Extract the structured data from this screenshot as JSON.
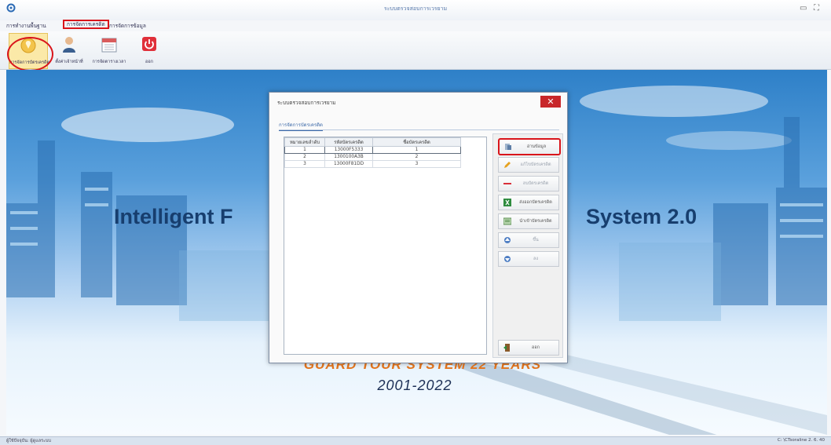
{
  "window": {
    "title": "ระบบตรวจสอบการเวรยาม",
    "minimize_glyph": "▭",
    "close_glyph": "⛶"
  },
  "menu": [
    {
      "label": "การทำงานพื้นฐาน",
      "active": false
    },
    {
      "label": "การจัดการเครดิต",
      "active": true
    },
    {
      "label": "การจัดการข้อมูล",
      "active": false
    }
  ],
  "ribbon": [
    {
      "label": "การจัดการบัตรเครดิต",
      "icon": "credit-card-icon",
      "selected": true
    },
    {
      "label": "ตั้งค่าเจ้าหน้าที่",
      "icon": "person-icon",
      "selected": false
    },
    {
      "label": "การจัดตารางเวลา",
      "icon": "calendar-icon",
      "selected": false
    },
    {
      "label": "ออก",
      "icon": "power-icon",
      "selected": false
    }
  ],
  "background": {
    "headline_left": "Intelligent F",
    "headline_right": "System 2.0",
    "tagline": "GUARD TOUR SYSTEM 22 YEARS",
    "years": "2001-2022"
  },
  "dialog": {
    "title": "ระบบตรวจสอบการเวรยาม",
    "close_glyph": "✕",
    "tab": "การจัดการบัตรเครดิต",
    "table": {
      "columns": [
        "หมายเลขลำดับ",
        "รหัสบัตรเครดิต",
        "ชื่อบัตรเครดิต"
      ],
      "rows": [
        [
          "1",
          "13000F5333",
          "1"
        ],
        [
          "2",
          "1300100A3B",
          "2"
        ],
        [
          "3",
          "13000F81DD",
          "3"
        ]
      ]
    },
    "buttons": [
      {
        "label": "อ่านข้อมูล",
        "icon": "read-card-icon",
        "enabled": true,
        "highlighted": true
      },
      {
        "label": "แก้ไขบัตรเครดิต",
        "icon": "pencil-icon",
        "enabled": false,
        "highlighted": false
      },
      {
        "label": "ลบบัตรเครดิต",
        "icon": "minus-icon",
        "enabled": false,
        "highlighted": false
      },
      {
        "label": "ส่งออกบัตรเครดิต",
        "icon": "excel-export-icon",
        "enabled": true,
        "highlighted": false
      },
      {
        "label": "นำเข้าบัตรเครดิต",
        "icon": "import-icon",
        "enabled": true,
        "highlighted": false
      },
      {
        "label": "ขึ้น",
        "icon": "up-icon",
        "enabled": false,
        "highlighted": false
      },
      {
        "label": "ลง",
        "icon": "down-icon",
        "enabled": false,
        "highlighted": false
      },
      {
        "label": "ออก",
        "icon": "exit-door-icon",
        "enabled": true,
        "highlighted": false
      }
    ]
  },
  "status": {
    "left": "ผู้ใช้ปัจจุบัน: ผู้ดูแลระบบ",
    "right": "C: \\CTsoraline 2. 6. 40"
  },
  "colors": {
    "highlight": "#d9151b",
    "accent": "#3c69a8",
    "sky_top": "#2e80c8",
    "tagline": "#e6761d"
  }
}
